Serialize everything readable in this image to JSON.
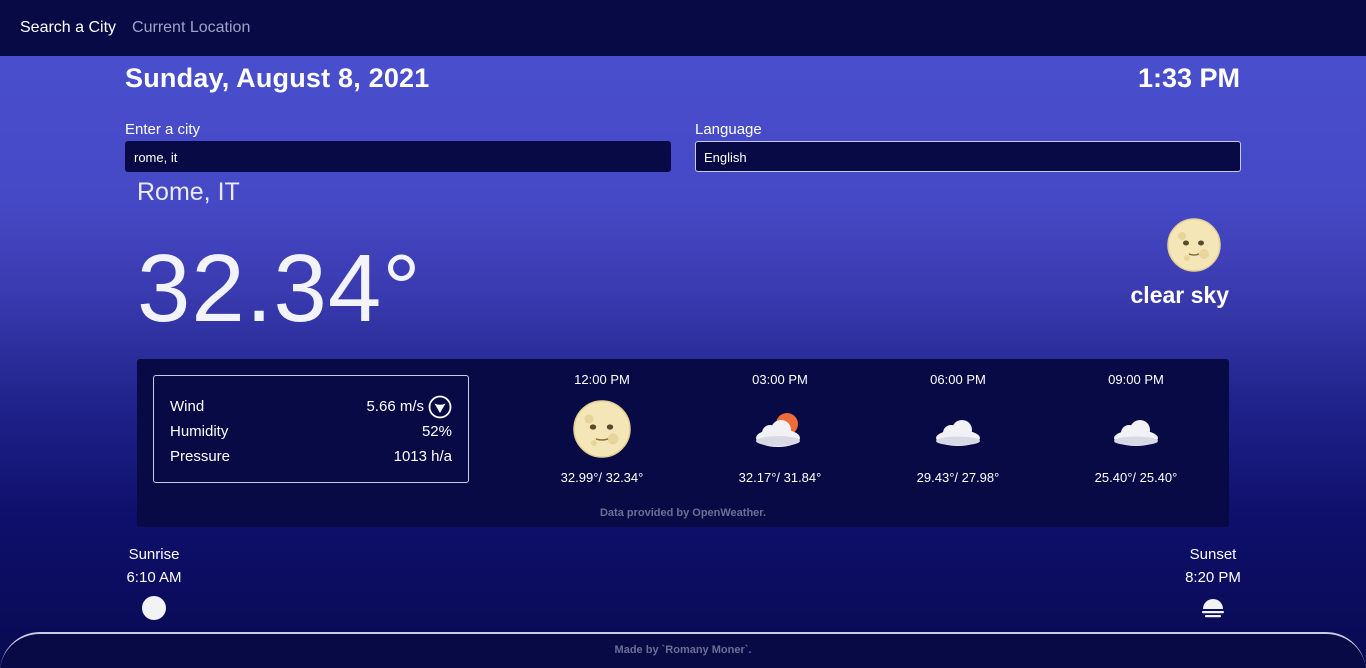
{
  "nav": {
    "search_city": "Search a City",
    "current_location": "Current Location"
  },
  "header": {
    "date": "Sunday, August 8, 2021",
    "time": "1:33 PM"
  },
  "form": {
    "city_label": "Enter a city",
    "city_value": "rome, it",
    "language_label": "Language",
    "language_value": "English"
  },
  "current": {
    "city": "Rome, IT",
    "temperature": "32.34°",
    "description": "clear sky",
    "icon": "full-moon-icon"
  },
  "stats": {
    "wind_label": "Wind",
    "wind_value": "5.66 m/s",
    "wind_icon": "wind-direction-icon",
    "humidity_label": "Humidity",
    "humidity_value": "52%",
    "pressure_label": "Pressure",
    "pressure_value": "1013 h/a"
  },
  "forecast": [
    {
      "time": "12:00 PM",
      "icon": "full-moon-icon",
      "range": "32.99°/ 32.34°"
    },
    {
      "time": "03:00 PM",
      "icon": "sun-behind-cloud-icon",
      "range": "32.17°/ 31.84°"
    },
    {
      "time": "06:00 PM",
      "icon": "cloud-icon",
      "range": "29.43°/ 27.98°"
    },
    {
      "time": "09:00 PM",
      "icon": "cloud-icon",
      "range": "25.40°/ 25.40°"
    }
  ],
  "credit": "Data provided by OpenWeather.",
  "sun": {
    "sunrise_label": "Sunrise",
    "sunrise_time": "6:10 AM",
    "sunset_label": "Sunset",
    "sunset_time": "8:20 PM"
  },
  "footer": "Made by `Romany Moner`.",
  "colors": {
    "nav_bg": "#080a45",
    "panel_bg": "#080a45",
    "gradient_top": "#4a50cf",
    "gradient_bottom": "#080a52",
    "muted_text": "#6b6e96"
  }
}
